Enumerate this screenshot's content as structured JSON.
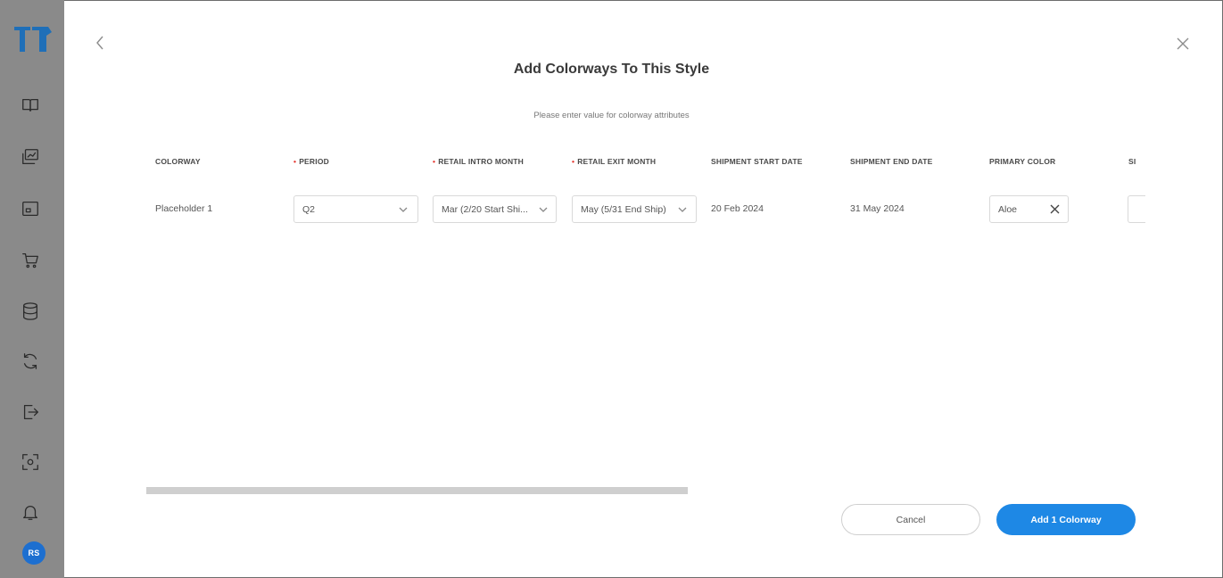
{
  "sidebar": {
    "logo": "tee-logo-icon",
    "icons": [
      "book-icon",
      "image-gallery-icon",
      "image-icon",
      "cart-icon",
      "database-icon",
      "sync-icon",
      "export-icon",
      "scan-icon",
      "bell-icon"
    ],
    "avatar_initials": "RS",
    "avatar_color": "#1d6fd0",
    "background": "#8a8a8a"
  },
  "dialog": {
    "title": "Add Colorways To This Style",
    "subtitle": "Please enter value for colorway attributes"
  },
  "table": {
    "columns": [
      {
        "label": "COLORWAY",
        "required": false
      },
      {
        "label": "PERIOD",
        "required": true
      },
      {
        "label": "RETAIL INTRO MONTH",
        "required": true
      },
      {
        "label": "RETAIL EXIT MONTH",
        "required": true
      },
      {
        "label": "SHIPMENT START DATE",
        "required": false
      },
      {
        "label": "SHIPMENT END DATE",
        "required": false
      },
      {
        "label": "PRIMARY COLOR",
        "required": false
      },
      {
        "label": "SI",
        "required": false
      }
    ],
    "required_marker": "•",
    "row": {
      "colorway": "Placeholder 1",
      "period": "Q2",
      "retail_intro_month": "Mar (2/20 Start Shi...",
      "retail_exit_month": "May (5/31 End Ship)",
      "shipment_start_date": "20 Feb 2024",
      "shipment_end_date": "31 May 2024",
      "primary_color": "Aloe"
    }
  },
  "footer": {
    "cancel_label": "Cancel",
    "submit_label": "Add 1 Colorway",
    "accent_color": "#1e88e5"
  }
}
